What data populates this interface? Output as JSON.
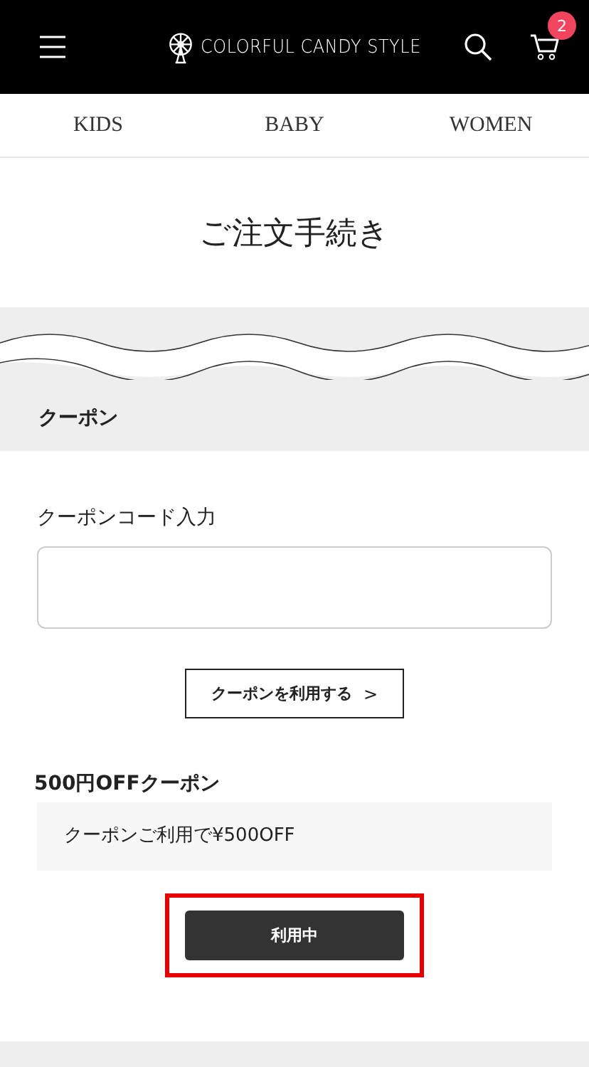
{
  "header": {
    "logo_text": "COLORFUL CANDY STYLE",
    "cart_count": "2"
  },
  "nav": [
    {
      "label": "KIDS"
    },
    {
      "label": "BABY"
    },
    {
      "label": "WOMEN"
    }
  ],
  "page_title": "ご注文手続き",
  "sections": [
    {
      "kind": "cut"
    },
    {
      "kind": "header",
      "title": "クーポン"
    }
  ],
  "coupon_form": {
    "label": "クーポンコード入力",
    "apply_button": "クーポンを利用する",
    "apply_caret": ">"
  },
  "coupon": {
    "name": "500円OFFクーポン",
    "description": "クーポンご利用で¥500OFF",
    "button": "利用中",
    "highlighted": true
  }
}
